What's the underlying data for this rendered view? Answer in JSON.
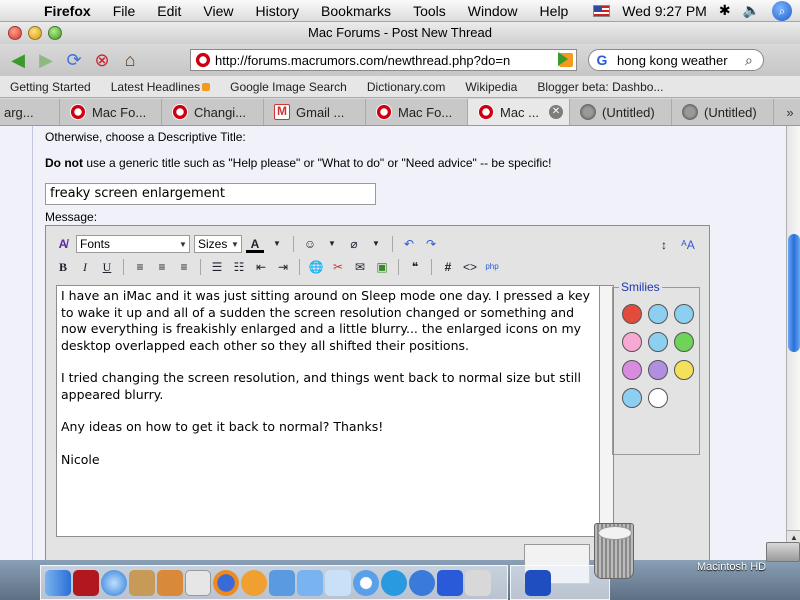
{
  "menubar": {
    "app": "Firefox",
    "items": [
      "File",
      "Edit",
      "View",
      "History",
      "Bookmarks",
      "Tools",
      "Window",
      "Help"
    ],
    "clock": "Wed 9:27 PM"
  },
  "window": {
    "title": "Mac Forums - Post New Thread"
  },
  "toolbar": {
    "url": "http://forums.macrumors.com/newthread.php?do=n",
    "search": "hong kong weather",
    "search_engine": "G"
  },
  "bookmarks": [
    "Getting Started",
    "Latest Headlines",
    "Google Image Search",
    "Dictionary.com",
    "Wikipedia",
    "Blogger beta: Dashbo..."
  ],
  "tabs": [
    {
      "label": "arg...",
      "icon": "macrumors-icon"
    },
    {
      "label": "Mac Fo...",
      "icon": "macrumors-icon"
    },
    {
      "label": "Changi...",
      "icon": "macrumors-icon"
    },
    {
      "label": "Gmail ...",
      "icon": "gmail-icon"
    },
    {
      "label": "Mac Fo...",
      "icon": "macrumors-icon"
    },
    {
      "label": "Mac ...",
      "icon": "macrumors-icon",
      "active": true
    },
    {
      "label": "(Untitled)",
      "icon": "globe-icon"
    },
    {
      "label": "(Untitled)",
      "icon": "globe-icon"
    }
  ],
  "form": {
    "desc_label": "Otherwise, choose a Descriptive Title:",
    "donot_bold": "Do not",
    "donot_rest": " use a generic title such as \"Help please\" or \"What to do\" or \"Need advice\" -- be specific!",
    "title_value": "freaky screen enlargement",
    "message_label": "Message:"
  },
  "editor": {
    "fonts_label": "Fonts",
    "sizes_label": "Sizes",
    "message_paragraphs": [
      "I have an iMac and it was just sitting around on Sleep mode one day. I pressed a key to wake it up and all of a sudden the screen resolution changed or something and now everything is freakishly enlarged and a little blurry... the enlarged icons on my desktop overlapped each other so they all shifted their positions.",
      "I tried changing the screen resolution, and things went back to normal size but still appeared blurry.",
      "Any ideas on how to get it back to normal? Thanks!",
      "Nicole"
    ],
    "smilies_title": "Smilies"
  },
  "desktop": {
    "hd_label": "Macintosh HD"
  },
  "colors": {
    "accent": "#2a6fd6",
    "content_bg": "#f1f2f9",
    "smilies_title": "#1a36b5"
  }
}
